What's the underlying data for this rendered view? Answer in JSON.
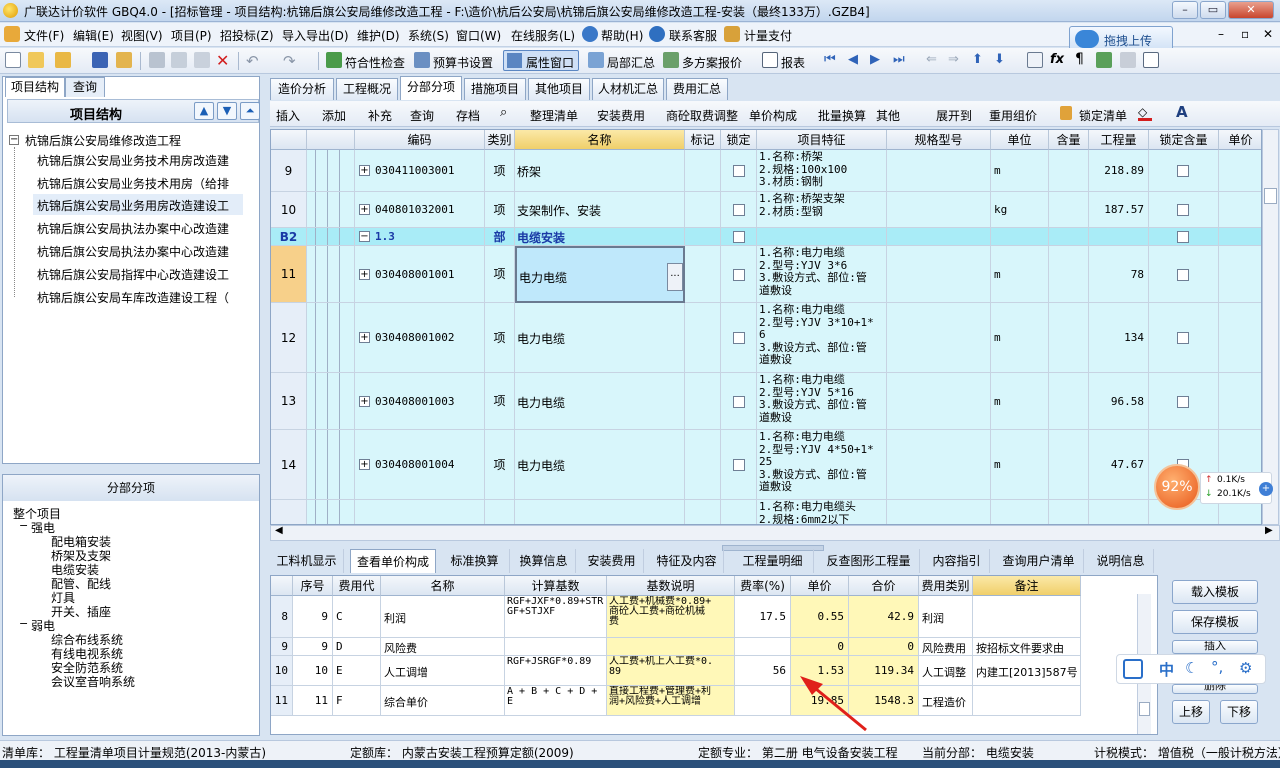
{
  "window": {
    "title": "广联达计价软件 GBQ4.0 - [招标管理 - 项目结构:杭锦后旗公安局维修改造工程 - F:\\造价\\杭后公安局\\杭锦后旗公安局维修改造工程-安装（最终133万）.GZB4]",
    "controls": [
      "–",
      "▭",
      "✕"
    ]
  },
  "menu": {
    "items": [
      "文件(F)",
      "编辑(E)",
      "视图(V)",
      "项目(P)",
      "招投标(Z)",
      "导入导出(D)",
      "维护(D)",
      "系统(S)",
      "窗口(W)",
      "在线服务(L)",
      "帮助(H)",
      "联系客服",
      "计量支付"
    ],
    "cloud_upload": "拖拽上传",
    "right_controls": [
      "–",
      "▫",
      "✕"
    ]
  },
  "toolbar1": {
    "labels": [
      "符合性检查",
      "预算书设置",
      "属性窗口",
      "局部汇总",
      "多方案报价",
      "报表"
    ]
  },
  "left_panel": {
    "tabs": [
      "项目结构",
      "查询"
    ],
    "header": "项目结构",
    "root": "杭锦后旗公安局维修改造工程",
    "children": [
      "杭锦后旗公安局业务技术用房改造建",
      "杭锦后旗公安局业务技术用房（给排",
      "杭锦后旗公安局业务用房改造建设工",
      "杭锦后旗公安局执法办案中心改造建",
      "杭锦后旗公安局执法办案中心改造建",
      "杭锦后旗公安局指挥中心改造建设工",
      "杭锦后旗公安局车库改造建设工程（"
    ]
  },
  "division_panel": {
    "header": "分部分项",
    "root": "整个项目",
    "group1": "强电",
    "group1_items": [
      "配电箱安装",
      "桥架及支架",
      "电缆安装",
      "配管、配线",
      "灯具",
      "开关、插座"
    ],
    "group2": "弱电",
    "group2_items": [
      "综合布线系统",
      "有线电视系统",
      "安全防范系统",
      "会议室音响系统"
    ]
  },
  "main_tabs": [
    "造价分析",
    "工程概况",
    "分部分项",
    "措施项目",
    "其他项目",
    "人材机汇总",
    "费用汇总"
  ],
  "toolbar2": [
    "插入",
    "添加",
    "补充",
    "查询",
    "存档",
    "整理清单",
    "安装费用",
    "商砼取费调整",
    "单价构成",
    "批量换算",
    "其他",
    "展开到",
    "重用组价",
    "锁定清单"
  ],
  "grid": {
    "headers": [
      "编码",
      "类别",
      "名称",
      "标记",
      "锁定综",
      "项目特征",
      "规格型号",
      "单位",
      "含量",
      "工程量",
      "锁定含量",
      "单价"
    ],
    "rows": [
      {
        "no": "9",
        "code": "030411003001",
        "type": "项",
        "name": "桥架",
        "features": [
          "1.名称:桥架",
          "2.规格:100x100",
          "3.材质:钢制"
        ],
        "unit": "m",
        "qty": "218.89"
      },
      {
        "no": "10",
        "code": "040801032001",
        "type": "项",
        "name": "支架制作、安装",
        "features": [
          "1.名称:桥架支架",
          "2.材质:型钢"
        ],
        "unit": "kg",
        "qty": "187.57"
      },
      {
        "no": "B2",
        "code": "1.3",
        "type": "部",
        "name": "电缆安装",
        "features": [],
        "unit": "",
        "qty": ""
      },
      {
        "no": "11",
        "code": "030408001001",
        "type": "项",
        "name": "电力电缆",
        "features": [
          "1.名称:电力电缆",
          "2.型号:YJV 3*6",
          "3.敷设方式、部位:管",
          "道敷设"
        ],
        "unit": "m",
        "qty": "78"
      },
      {
        "no": "12",
        "code": "030408001002",
        "type": "项",
        "name": "电力电缆",
        "features": [
          "1.名称:电力电缆",
          "2.型号:YJV 3*10+1*",
          "6",
          "3.敷设方式、部位:管",
          "道敷设"
        ],
        "unit": "m",
        "qty": "134"
      },
      {
        "no": "13",
        "code": "030408001003",
        "type": "项",
        "name": "电力电缆",
        "features": [
          "1.名称:电力电缆",
          "2.型号:YJV 5*16",
          "3.敷设方式、部位:管",
          "道敷设"
        ],
        "unit": "m",
        "qty": "96.58"
      },
      {
        "no": "14",
        "code": "030408001004",
        "type": "项",
        "name": "电力电缆",
        "features": [
          "1.名称:电力电缆",
          "2.型号:YJV 4*50+1*",
          "25",
          "3.敷设方式、部位:管",
          "道敷设"
        ],
        "unit": "m",
        "qty": "47.67"
      },
      {
        "no": "",
        "code": "",
        "type": "",
        "name": "",
        "features": [
          "1.名称:电力电缆头",
          "2.规格:6mm2以下"
        ],
        "unit": "",
        "qty": ""
      }
    ]
  },
  "bottom_tabs": [
    "工料机显示",
    "查看单价构成",
    "标准换算",
    "换算信息",
    "安装费用",
    "特征及内容",
    "工程量明细",
    "反查图形工程量",
    "内容指引",
    "查询用户清单",
    "说明信息"
  ],
  "bottom_grid": {
    "headers": [
      "序号",
      "费用代号",
      "名称",
      "计算基数",
      "基数说明",
      "费率(%)",
      "单价",
      "合价",
      "费用类别",
      "备注"
    ],
    "rows": [
      {
        "idx": "8",
        "seq": "9",
        "code": "C",
        "name": "利润",
        "base": [
          "RGF+JXF*0.89+STR",
          "GF+STJXF"
        ],
        "desc": [
          "人工费+机械费*0.89+",
          "商砼人工费+商砼机械",
          "费"
        ],
        "rate": "17.5",
        "price": "0.55",
        "total": "42.9",
        "cat": "利润",
        "note": ""
      },
      {
        "idx": "9",
        "seq": "9",
        "code": "D",
        "name": "风险费",
        "base": [
          ""
        ],
        "desc": [
          ""
        ],
        "rate": "",
        "price": "0",
        "total": "0",
        "cat": "风险费用",
        "note": "按招标文件要求由"
      },
      {
        "idx": "10",
        "seq": "10",
        "code": "E",
        "name": "人工调增",
        "base": [
          "RGF+JSRGF*0.89"
        ],
        "desc": [
          "人工费+机上人工费*0.",
          "89"
        ],
        "rate": "56",
        "price": "1.53",
        "total": "119.34",
        "cat": "人工调整",
        "note": "内建工[2013]587号"
      },
      {
        "idx": "11",
        "seq": "11",
        "code": "F",
        "name": "综合单价",
        "base": [
          "A + B + C + D +",
          "E"
        ],
        "desc": [
          "直接工程费+管理费+利",
          "润+风险费+人工调增"
        ],
        "rate": "",
        "price": "19.85",
        "total": "1548.3",
        "cat": "工程造价",
        "note": ""
      }
    ]
  },
  "right_buttons": [
    "载入模板",
    "保存模板",
    "插入",
    "删除",
    "上移",
    "下移"
  ],
  "status": {
    "list_lib": "清单库：  工程量清单项目计量规范(2013-内蒙古)",
    "quota_lib": "定额库：  内蒙古安装工程预算定额(2009)",
    "quota_major": "定额专业：  第二册  电气设备安装工程",
    "current": "当前分部：  电缆安装",
    "tax": "计税模式：  增值税（一般计税方法）"
  },
  "net_widget": {
    "percent": "92%",
    "up": "0.1K/s",
    "down": "20.1K/s"
  },
  "ime": {
    "lang": "中"
  }
}
